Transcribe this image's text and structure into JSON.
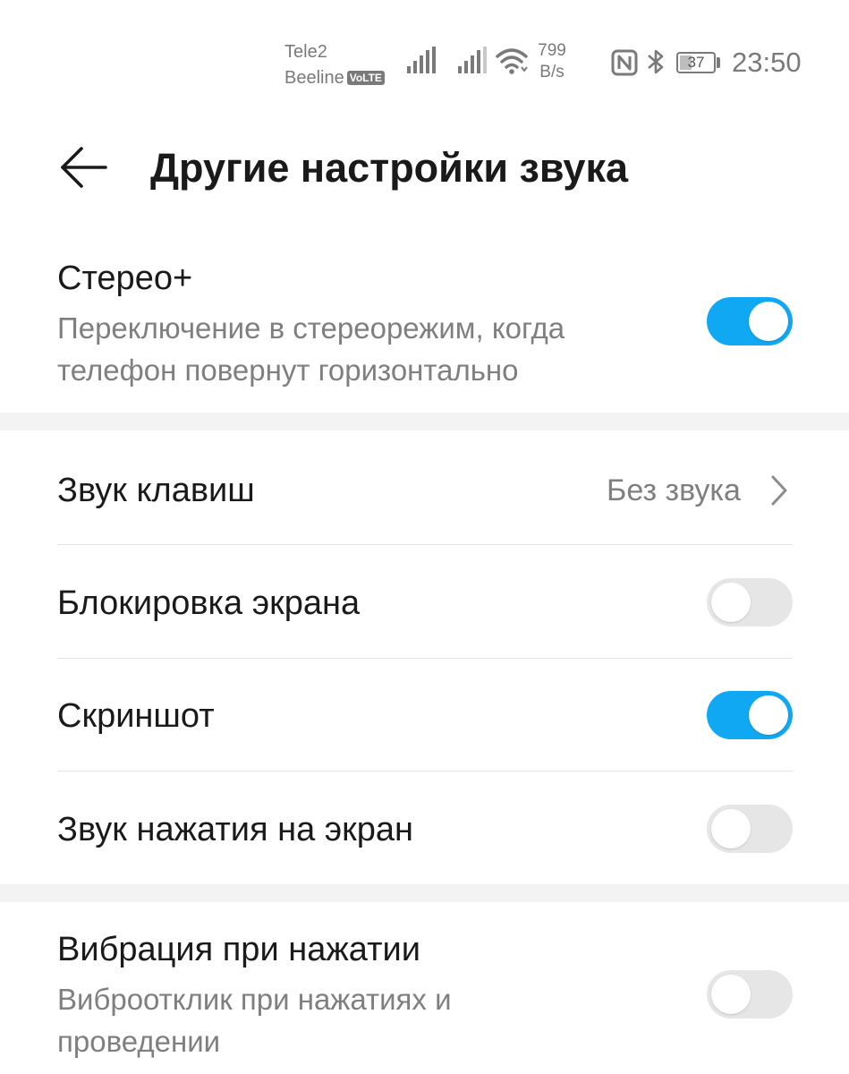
{
  "status_bar": {
    "carrier1": "Tele2",
    "carrier2": "Beeline",
    "volte": "VoLTE",
    "net_speed_value": "799",
    "net_speed_unit": "B/s",
    "battery": "37",
    "battery_level_percent": 37,
    "time": "23:50",
    "icons": [
      "signal-icon",
      "signal-icon",
      "wifi-icon",
      "nfc-icon",
      "bluetooth-icon",
      "battery-icon"
    ]
  },
  "header": {
    "title": "Другие настройки звука",
    "back_icon": "arrow-left-icon"
  },
  "settings": {
    "stereo": {
      "label": "Стерео+",
      "description": "Переключение в стереорежим, когда телефон повернут горизонтально",
      "enabled": true
    },
    "keypad": {
      "label": "Звук клавиш",
      "value": "Без звука",
      "icon": "chevron-right-icon"
    },
    "screen_lock": {
      "label": "Блокировка экрана",
      "enabled": false
    },
    "screenshot": {
      "label": "Скриншот",
      "enabled": true
    },
    "touch_sound": {
      "label": "Звук нажатия на экран",
      "enabled": false
    },
    "haptic": {
      "label": "Вибрация при нажатии",
      "description": "Виброотклик при нажатиях и проведении",
      "enabled": false
    }
  },
  "colors": {
    "toggle_on": "#10a8f2",
    "toggle_off": "#e6e6e6",
    "secondary_text": "#7f7f7f",
    "section_band": "#f3f3f3"
  }
}
